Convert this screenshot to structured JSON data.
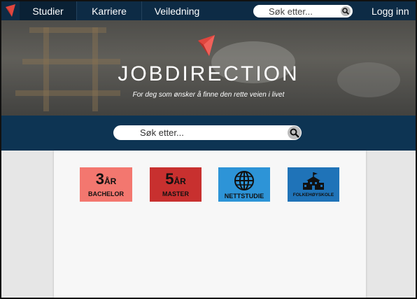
{
  "nav": {
    "items": [
      {
        "label": "Studier",
        "active": true
      },
      {
        "label": "Karriere",
        "active": false
      },
      {
        "label": "Veiledning",
        "active": false
      }
    ],
    "search_placeholder": "Søk etter...",
    "login_label": "Logg inn"
  },
  "hero": {
    "title": "JOBDIRECTION",
    "subtitle": "For deg som ønsker å finne den rette veien i livet"
  },
  "main_search": {
    "placeholder": "Søk etter..."
  },
  "tiles": [
    {
      "number": "3",
      "unit": "ÅR",
      "label": "BACHELOR",
      "color": "#f3776f"
    },
    {
      "number": "5",
      "unit": "ÅR",
      "label": "MASTER",
      "color": "#c8302f"
    },
    {
      "icon": "globe-icon",
      "label": "NETTSTUDIE",
      "color": "#2d94d7"
    },
    {
      "icon": "school-building-icon",
      "label": "FOLKEHØYSKOLE",
      "color": "#1f73b8"
    }
  ],
  "colors": {
    "nav_bg": "#0d2b45",
    "search_band": "#0d3453",
    "brand_red": "#e0463e"
  }
}
